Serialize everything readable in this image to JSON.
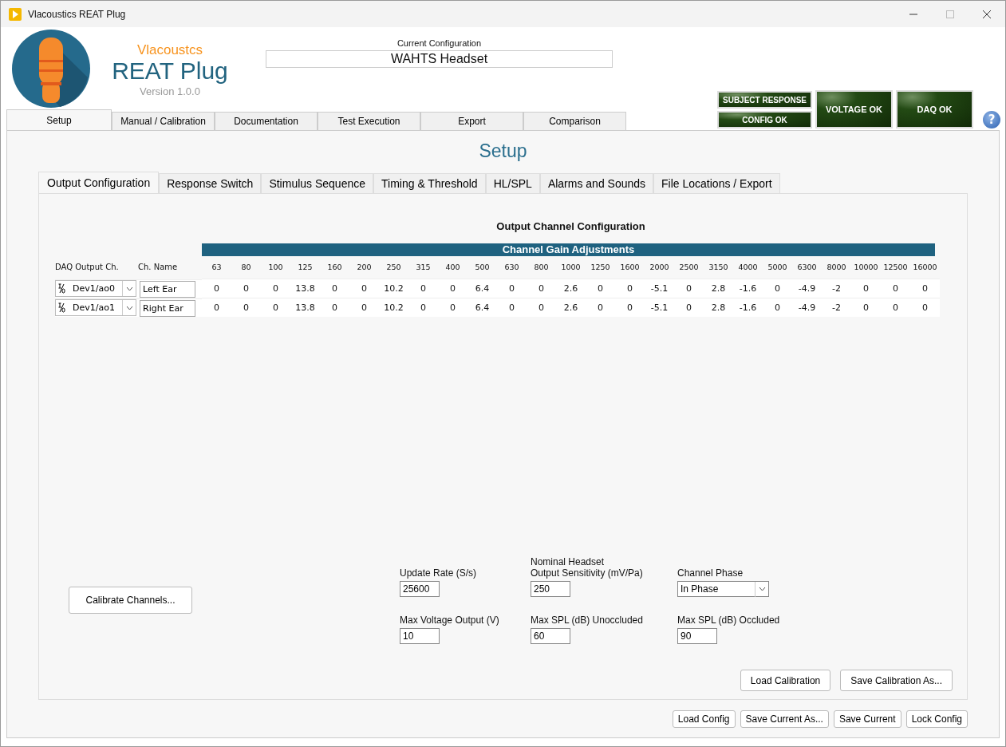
{
  "window": {
    "title": "Vlacoustics REAT Plug"
  },
  "header": {
    "brand": "Vlacoustcs",
    "product": "REAT Plug",
    "version": "Version 1.0.0",
    "current_configuration": {
      "label": "Current Configuration",
      "value": "WAHTS Headset"
    }
  },
  "indicators": [
    {
      "label": "SUBJECT RESPONSE",
      "kind": "small"
    },
    {
      "label": "CONFIG OK",
      "kind": "small"
    },
    {
      "label": "VOLTAGE OK",
      "kind": "large"
    },
    {
      "label": "DAQ OK",
      "kind": "large"
    }
  ],
  "help": "?",
  "main_tabs": [
    {
      "label": "Setup",
      "selected": true
    },
    {
      "label": "Manual / Calibration",
      "selected": false
    },
    {
      "label": "Documentation",
      "selected": false
    },
    {
      "label": "Test Execution",
      "selected": false
    },
    {
      "label": "Export",
      "selected": false
    },
    {
      "label": "Comparison",
      "selected": false
    }
  ],
  "page_title": "Setup",
  "sub_tabs": [
    {
      "label": "Output Configuration",
      "selected": true
    },
    {
      "label": "Response Switch",
      "selected": false
    },
    {
      "label": "Stimulus Sequence",
      "selected": false
    },
    {
      "label": "Timing & Threshold",
      "selected": false
    },
    {
      "label": "HL/SPL",
      "selected": false
    },
    {
      "label": "Alarms and Sounds",
      "selected": false
    },
    {
      "label": "File Locations / Export",
      "selected": false
    }
  ],
  "output_config": {
    "title": "Output Channel Configuration",
    "gain_header": "Channel Gain Adjustments",
    "daq_column": "DAQ Output Ch.",
    "name_column": "Ch. Name",
    "frequencies": [
      "63",
      "80",
      "100",
      "125",
      "160",
      "200",
      "250",
      "315",
      "400",
      "500",
      "630",
      "800",
      "1000",
      "1250",
      "1600",
      "2000",
      "2500",
      "3150",
      "4000",
      "5000",
      "6300",
      "8000",
      "10000",
      "12500",
      "16000"
    ],
    "channels": [
      {
        "daq": "Dev1/ao0",
        "name": "Left Ear",
        "gains": [
          "0",
          "0",
          "0",
          "13.8",
          "0",
          "0",
          "10.2",
          "0",
          "0",
          "6.4",
          "0",
          "0",
          "2.6",
          "0",
          "0",
          "-5.1",
          "0",
          "2.8",
          "-1.6",
          "0",
          "-4.9",
          "-2",
          "0",
          "0",
          "0"
        ]
      },
      {
        "daq": "Dev1/ao1",
        "name": "Right Ear",
        "gains": [
          "0",
          "0",
          "0",
          "13.8",
          "0",
          "0",
          "10.2",
          "0",
          "0",
          "6.4",
          "0",
          "0",
          "2.6",
          "0",
          "0",
          "-5.1",
          "0",
          "2.8",
          "-1.6",
          "0",
          "-4.9",
          "-2",
          "0",
          "0",
          "0"
        ]
      }
    ]
  },
  "calibrate_button": "Calibrate Channels...",
  "fields": [
    {
      "label": "Update Rate (S/s)",
      "value": "25600",
      "kind": "text"
    },
    {
      "label": "Nominal Headset\nOutput Sensitivity (mV/Pa)",
      "value": "250",
      "kind": "text"
    },
    {
      "label": "Channel Phase",
      "value": "In Phase",
      "kind": "dropdown"
    },
    {
      "label": "Max Voltage Output (V)",
      "value": "10",
      "kind": "text"
    },
    {
      "label": "Max SPL (dB) Unoccluded",
      "value": "60",
      "kind": "text"
    },
    {
      "label": "Max SPL (dB) Occluded",
      "value": "90",
      "kind": "text"
    }
  ],
  "calibration_buttons": [
    "Load Calibration",
    "Save Calibration As..."
  ],
  "config_buttons": [
    "Load Config",
    "Save Current As...",
    "Save Current",
    "Lock Config"
  ]
}
